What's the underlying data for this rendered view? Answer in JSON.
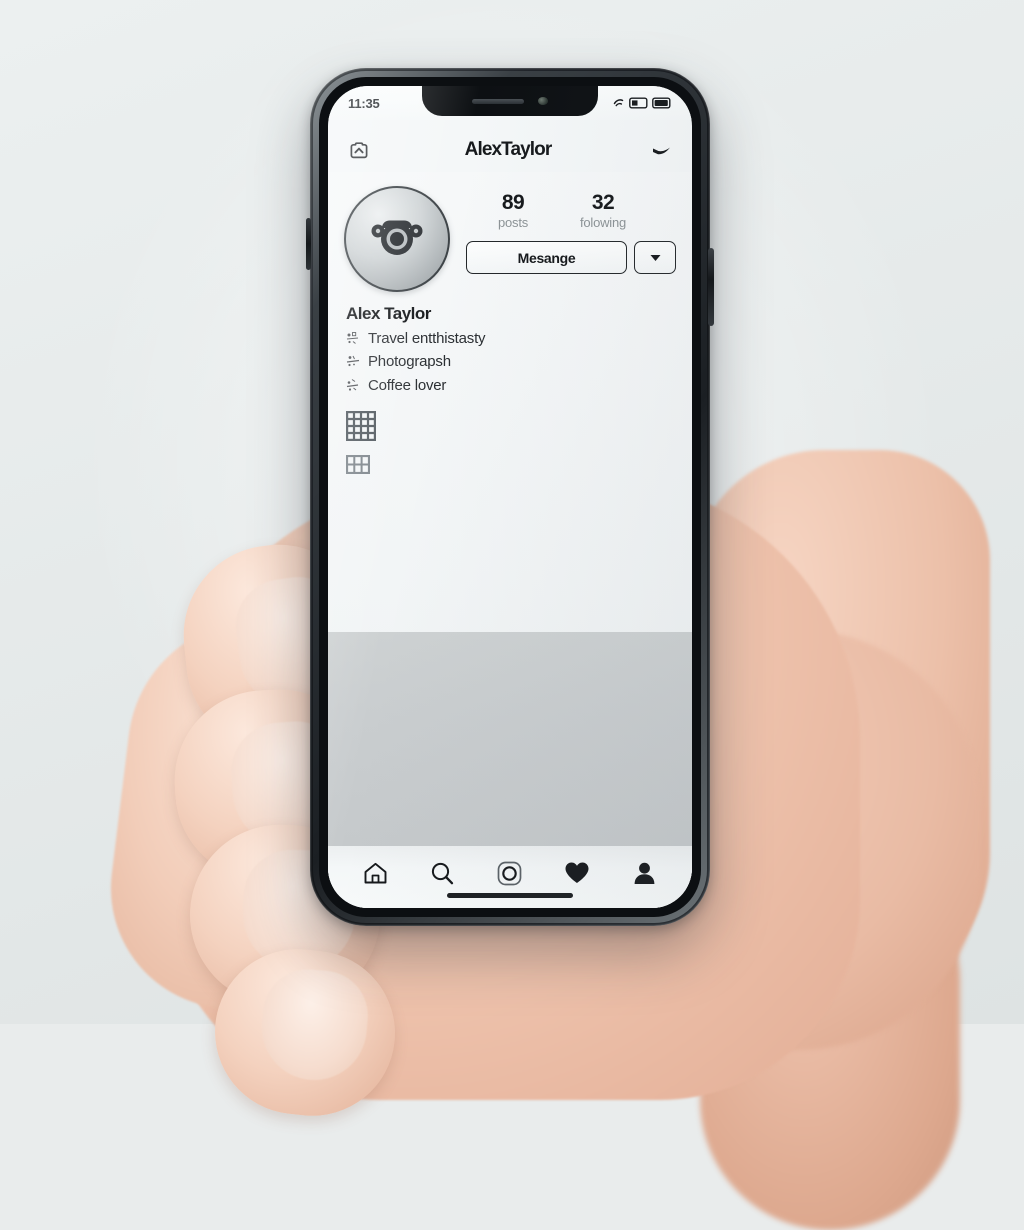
{
  "scene": {
    "description": "A hand holding a smartphone showing a social media profile app",
    "background_color": "#e9ecec"
  },
  "phone": {
    "frame_color": "#15181b",
    "screen_background": "#f4f7f8"
  },
  "status_bar": {
    "time": "11:35",
    "icons": [
      "wifi-icon",
      "battery-outline-icon",
      "battery-filled-icon"
    ]
  },
  "app_header": {
    "left_icon": "badge-chevron-up-icon",
    "title": "AlexTaylor",
    "right_icon": "checkmark-swoosh-icon"
  },
  "profile": {
    "avatar_icon": "camera-lens-avatar-icon",
    "stats": [
      {
        "number": "89",
        "label": "posts"
      },
      {
        "number": "32",
        "label": "folowing"
      }
    ],
    "actions": {
      "message_label": "Mesange",
      "caret_icon": "caret-down-icon"
    },
    "bio": {
      "display_name": "Alex Taylor",
      "lines": [
        {
          "glyph": "sparkle-glyph-icon",
          "text": "Travel entthistasty"
        },
        {
          "glyph": "sparkle-glyph-icon",
          "text": "Photograpsh"
        },
        {
          "glyph": "sparkle-glyph-icon",
          "text": "Coffee lover"
        }
      ]
    },
    "tabs": [
      {
        "icon": "grid-4x4-icon",
        "state": "active"
      },
      {
        "icon": "grid-3x2-icon",
        "state": "inactive"
      }
    ]
  },
  "bottom_nav": {
    "items": [
      {
        "icon": "home-icon",
        "label": "Home"
      },
      {
        "icon": "search-icon",
        "label": "Search"
      },
      {
        "icon": "reels-camera-icon",
        "label": "Reels"
      },
      {
        "icon": "heart-icon",
        "label": "Activity"
      },
      {
        "icon": "profile-person-icon",
        "label": "Profile"
      }
    ],
    "home_indicator": "home-indicator-bar"
  },
  "colors": {
    "text_primary": "#15181b",
    "text_muted": "#8c9396",
    "accent_border": "#23272a",
    "content_gray": "#c9cdcf"
  }
}
